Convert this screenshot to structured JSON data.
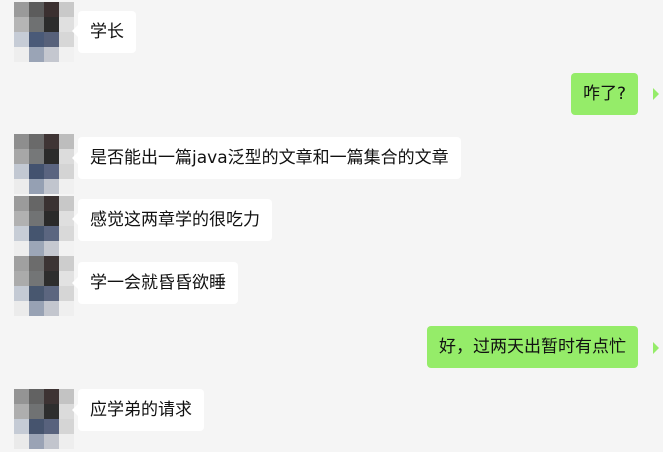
{
  "conversation": {
    "messages": [
      {
        "side": "left",
        "text": "学长"
      },
      {
        "side": "right",
        "text": "咋了?"
      },
      {
        "side": "left",
        "text": "是否能出一篇java泛型的文章和一篇集合的文章"
      },
      {
        "side": "left",
        "text": "感觉这两章学的很吃力"
      },
      {
        "side": "left",
        "text": "学一会就昏昏欲睡"
      },
      {
        "side": "right",
        "text": "好，过两天出暂时有点忙"
      },
      {
        "side": "left",
        "text": "应学弟的请求"
      }
    ]
  },
  "colors": {
    "background": "#f5f5f5",
    "incoming_bubble": "#ffffff",
    "outgoing_bubble": "#95ec69"
  },
  "icons": {
    "avatar": "pixelated-avatar-icon"
  }
}
